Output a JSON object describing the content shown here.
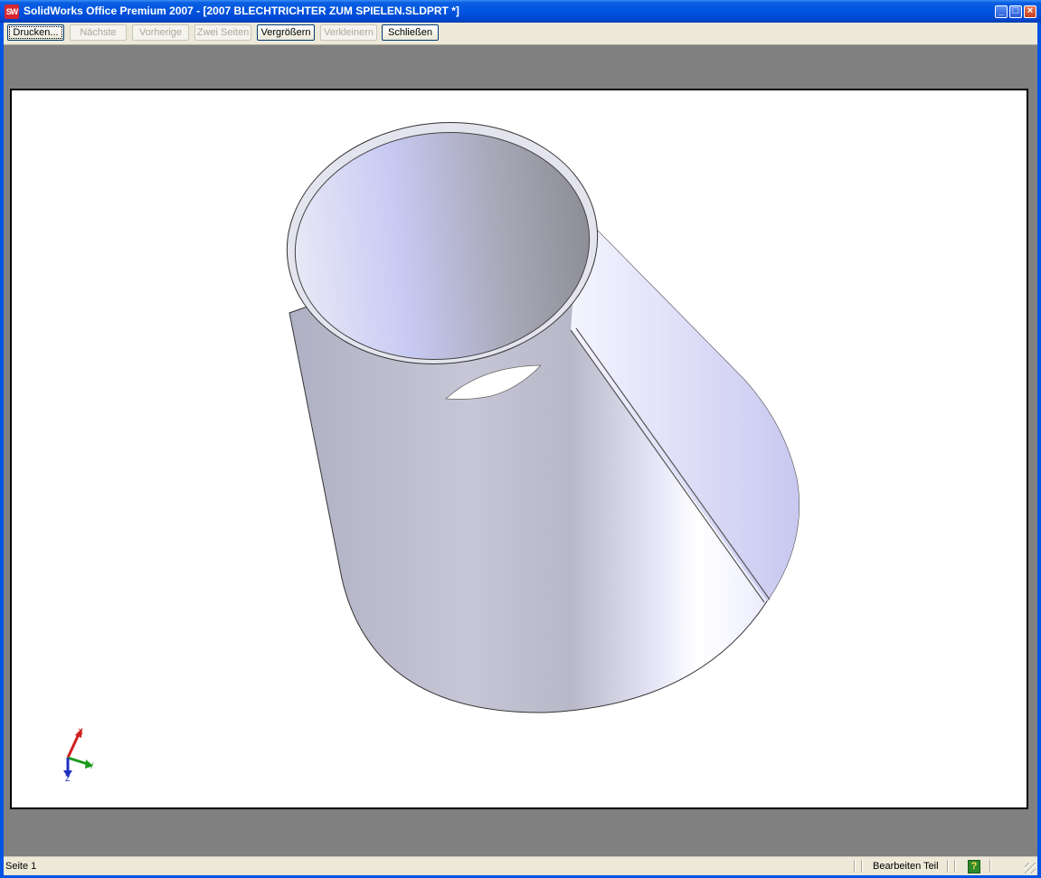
{
  "window": {
    "title": "SolidWorks Office Premium 2007 - [2007 BLECHTRICHTER ZUM SPIELEN.SLDPRT *]",
    "icon": "solidworks-logo-icon",
    "icon_text": "SW"
  },
  "toolbar": {
    "buttons": [
      {
        "label": "Drucken...",
        "enabled": true
      },
      {
        "label": "Nächste",
        "enabled": false
      },
      {
        "label": "Vorherige",
        "enabled": false
      },
      {
        "label": "Zwei Seiten",
        "enabled": false
      },
      {
        "label": "Vergrößern",
        "enabled": true
      },
      {
        "label": "Verkleinern",
        "enabled": false
      },
      {
        "label": "Schließen",
        "enabled": true
      }
    ]
  },
  "preview": {
    "axis_labels": {
      "x": "X",
      "y": "Y",
      "z": "Z"
    },
    "axis_colors": {
      "x": "#d02020",
      "y": "#1a9a1a",
      "z": "#2030c0"
    },
    "model_color": "#c8c8d8"
  },
  "statusbar": {
    "page": "Seite 1",
    "mode": "Bearbeiten Teil",
    "help_icon": "help-question-icon",
    "help_text": "?"
  }
}
